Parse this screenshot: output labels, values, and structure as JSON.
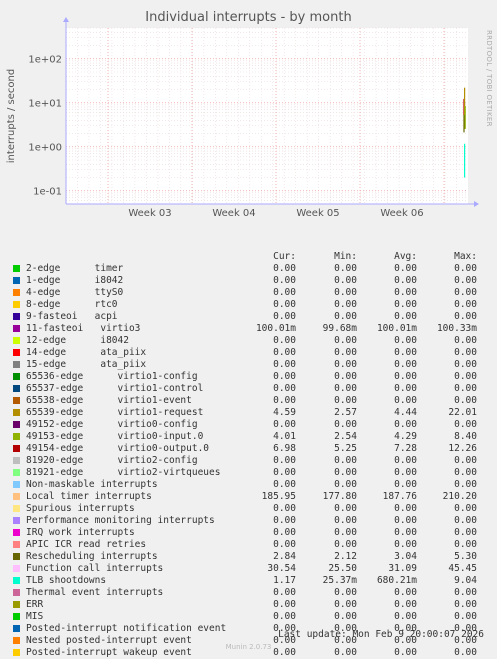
{
  "title": "Individual interrupts - by month",
  "brand": "RRDTOOL / TOBI OETIKER",
  "footer": "Last update: Mon Feb  9 20:00:07 2026",
  "version": "Munin 2.0.73",
  "columns": [
    "Cur:",
    "Min:",
    "Avg:",
    "Max:"
  ],
  "chart_data": {
    "type": "line",
    "title": "Individual interrupts - by month",
    "ylabel": "interrupts / second",
    "yscale": "log",
    "ylim": [
      0.05,
      500
    ],
    "yticks": [
      {
        "value": 0.1,
        "label": "1e-01"
      },
      {
        "value": 1,
        "label": "1e+00"
      },
      {
        "value": 10,
        "label": "1e+01"
      },
      {
        "value": 100,
        "label": "1e+02"
      }
    ],
    "xticks": [
      "Week 03",
      "Week 04",
      "Week 05",
      "Week 06"
    ],
    "grid": true,
    "series": [
      {
        "name": "2-edge      timer",
        "color": "#00cc00",
        "cur": "0.00",
        "min": "0.00",
        "avg": "0.00",
        "max": "0.00"
      },
      {
        "name": "1-edge      i8042",
        "color": "#0066b3",
        "cur": "0.00",
        "min": "0.00",
        "avg": "0.00",
        "max": "0.00"
      },
      {
        "name": "4-edge      ttyS0",
        "color": "#ff8000",
        "cur": "0.00",
        "min": "0.00",
        "avg": "0.00",
        "max": "0.00"
      },
      {
        "name": "8-edge      rtc0",
        "color": "#ffcc00",
        "cur": "0.00",
        "min": "0.00",
        "avg": "0.00",
        "max": "0.00"
      },
      {
        "name": "9-fasteoi   acpi",
        "color": "#330099",
        "cur": "0.00",
        "min": "0.00",
        "avg": "0.00",
        "max": "0.00"
      },
      {
        "name": "11-fasteoi   virtio3",
        "color": "#990099",
        "cur": "100.01m",
        "min": "99.68m",
        "avg": "100.01m",
        "max": "100.33m"
      },
      {
        "name": "12-edge      i8042",
        "color": "#ccff00",
        "cur": "0.00",
        "min": "0.00",
        "avg": "0.00",
        "max": "0.00"
      },
      {
        "name": "14-edge      ata_piix",
        "color": "#ff0000",
        "cur": "0.00",
        "min": "0.00",
        "avg": "0.00",
        "max": "0.00"
      },
      {
        "name": "15-edge      ata_piix",
        "color": "#808080",
        "cur": "0.00",
        "min": "0.00",
        "avg": "0.00",
        "max": "0.00"
      },
      {
        "name": "65536-edge      virtio1-config",
        "color": "#008f00",
        "cur": "0.00",
        "min": "0.00",
        "avg": "0.00",
        "max": "0.00"
      },
      {
        "name": "65537-edge      virtio1-control",
        "color": "#00487d",
        "cur": "0.00",
        "min": "0.00",
        "avg": "0.00",
        "max": "0.00"
      },
      {
        "name": "65538-edge      virtio1-event",
        "color": "#b35a00",
        "cur": "0.00",
        "min": "0.00",
        "avg": "0.00",
        "max": "0.00"
      },
      {
        "name": "65539-edge      virtio1-request",
        "color": "#b38f00",
        "cur": "4.59",
        "min": "2.57",
        "avg": "4.44",
        "max": "22.01"
      },
      {
        "name": "49152-edge      virtio0-config",
        "color": "#6b006b",
        "cur": "0.00",
        "min": "0.00",
        "avg": "0.00",
        "max": "0.00"
      },
      {
        "name": "49153-edge      virtio0-input.0",
        "color": "#8fb300",
        "cur": "4.01",
        "min": "2.54",
        "avg": "4.29",
        "max": "8.40"
      },
      {
        "name": "49154-edge      virtio0-output.0",
        "color": "#b30000",
        "cur": "6.98",
        "min": "5.25",
        "avg": "7.28",
        "max": "12.26"
      },
      {
        "name": "81920-edge      virtio2-config",
        "color": "#bebebe",
        "cur": "0.00",
        "min": "0.00",
        "avg": "0.00",
        "max": "0.00"
      },
      {
        "name": "81921-edge      virtio2-virtqueues",
        "color": "#80ff80",
        "cur": "0.00",
        "min": "0.00",
        "avg": "0.00",
        "max": "0.00"
      },
      {
        "name": "Non-maskable interrupts",
        "color": "#80c9ff",
        "cur": "0.00",
        "min": "0.00",
        "avg": "0.00",
        "max": "0.00"
      },
      {
        "name": "Local timer interrupts",
        "color": "#ffc080",
        "cur": "185.95",
        "min": "177.80",
        "avg": "187.76",
        "max": "210.20"
      },
      {
        "name": "Spurious interrupts",
        "color": "#ffe680",
        "cur": "0.00",
        "min": "0.00",
        "avg": "0.00",
        "max": "0.00"
      },
      {
        "name": "Performance monitoring interrupts",
        "color": "#aa80ff",
        "cur": "0.00",
        "min": "0.00",
        "avg": "0.00",
        "max": "0.00"
      },
      {
        "name": "IRQ work interrupts",
        "color": "#ee00cc",
        "cur": "0.00",
        "min": "0.00",
        "avg": "0.00",
        "max": "0.00"
      },
      {
        "name": "APIC ICR read retries",
        "color": "#ff8080",
        "cur": "0.00",
        "min": "0.00",
        "avg": "0.00",
        "max": "0.00"
      },
      {
        "name": "Rescheduling interrupts",
        "color": "#666600",
        "cur": "2.84",
        "min": "2.12",
        "avg": "3.04",
        "max": "5.30"
      },
      {
        "name": "Function call interrupts",
        "color": "#ffbfff",
        "cur": "30.54",
        "min": "25.50",
        "avg": "31.09",
        "max": "45.45"
      },
      {
        "name": "TLB shootdowns",
        "color": "#00ffcc",
        "cur": "1.17",
        "min": "25.37m",
        "avg": "680.21m",
        "max": "9.04"
      },
      {
        "name": "Thermal event interrupts",
        "color": "#cc6699",
        "cur": "0.00",
        "min": "0.00",
        "avg": "0.00",
        "max": "0.00"
      },
      {
        "name": "ERR",
        "color": "#999900",
        "cur": "0.00",
        "min": "0.00",
        "avg": "0.00",
        "max": "0.00"
      },
      {
        "name": "MIS",
        "color": "#00cc00",
        "cur": "0.00",
        "min": "0.00",
        "avg": "0.00",
        "max": "0.00"
      },
      {
        "name": "Posted-interrupt notification event",
        "color": "#0066b3",
        "cur": "0.00",
        "min": "0.00",
        "avg": "0.00",
        "max": "0.00"
      },
      {
        "name": "Nested posted-interrupt event",
        "color": "#ff8000",
        "cur": "0.00",
        "min": "0.00",
        "avg": "0.00",
        "max": "0.00"
      },
      {
        "name": "Posted-interrupt wakeup event",
        "color": "#ffcc00",
        "cur": "0.00",
        "min": "0.00",
        "avg": "0.00",
        "max": "0.00"
      }
    ],
    "visible_lines": [
      {
        "name": "49154-edge      virtio0-output.0",
        "color": "#b30000",
        "y": [
          5.25,
          12.26
        ]
      },
      {
        "name": "65539-edge      virtio1-request",
        "color": "#b38f00",
        "y": [
          2.57,
          22.01
        ]
      },
      {
        "name": "49153-edge      virtio0-input.0",
        "color": "#8fb300",
        "y": [
          2.54,
          8.4
        ]
      },
      {
        "name": "Rescheduling interrupts",
        "color": "#666600",
        "y": [
          2.12,
          5.3
        ]
      },
      {
        "name": "TLB shootdowns",
        "color": "#00ffcc",
        "y": [
          0.2,
          1.17
        ]
      },
      {
        "name": "11-fasteoi   virtio3",
        "color": "#990099",
        "y": [
          0.0997,
          0.1003
        ]
      }
    ]
  }
}
